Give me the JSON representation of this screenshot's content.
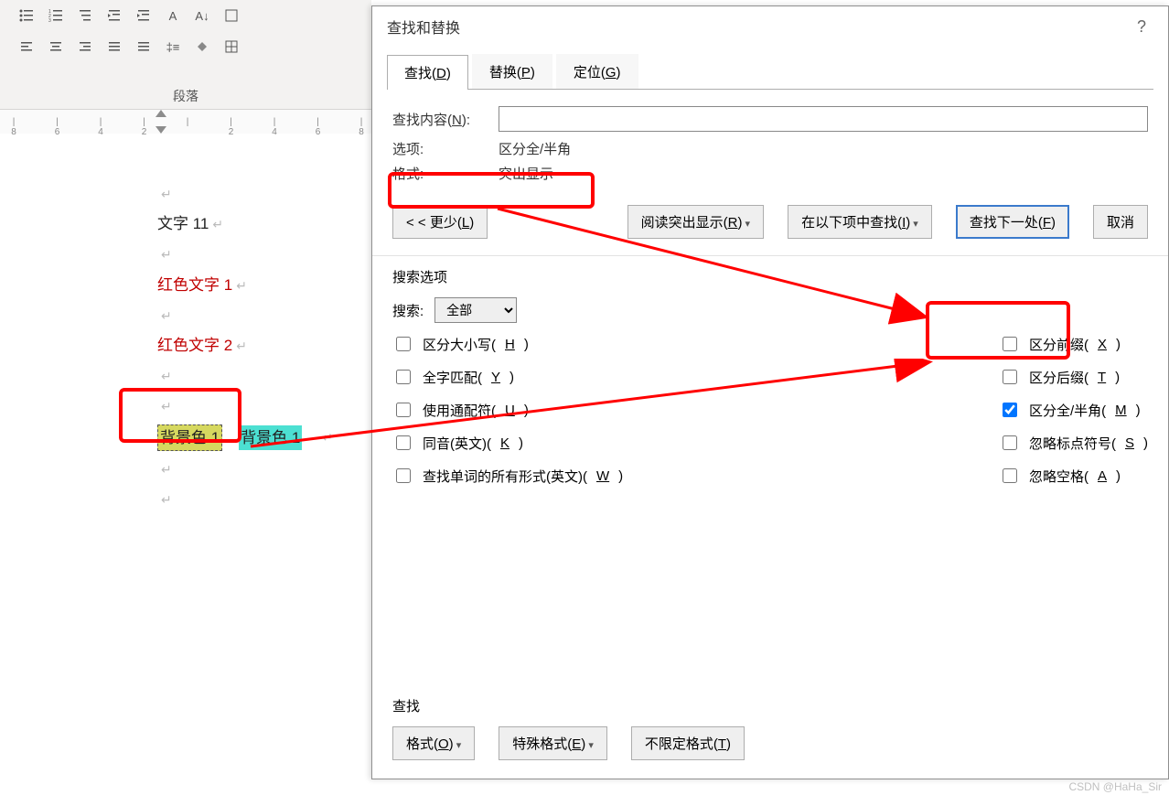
{
  "ribbon": {
    "group_label": "段落"
  },
  "document": {
    "line1": "文字 11",
    "red1": "红色文字 1",
    "red2": "红色文字 2",
    "hl_yellow": "背景色 1",
    "hl_cyan": "背景色 1"
  },
  "dialog": {
    "title": "查找和替换",
    "help": "?",
    "tabs": {
      "find": "查找(D)",
      "replace": "替换(P)",
      "goto": "定位(G)"
    },
    "find_content_label": "查找内容(N):",
    "options_label": "选项:",
    "options_value": "区分全/半角",
    "format_label": "格式:",
    "format_value": "突出显示",
    "buttons": {
      "less": "< < 更少(L)",
      "reading_highlight": "阅读突出显示(R)",
      "find_in": "在以下项中查找(I)",
      "find_next": "查找下一处(F)",
      "cancel": "取消"
    },
    "search_options": {
      "title": "搜索选项",
      "search_label": "搜索:",
      "search_value": "全部",
      "match_case": "区分大小写(H)",
      "whole_word": "全字匹配(Y)",
      "wildcards": "使用通配符(U)",
      "sounds_like": "同音(英文)(K)",
      "word_forms": "查找单词的所有形式(英文)(W)",
      "prefix": "区分前缀(X)",
      "suffix": "区分后缀(T)",
      "full_half": "区分全/半角(M)",
      "punctuation": "忽略标点符号(S)",
      "whitespace": "忽略空格(A)"
    },
    "find_section": {
      "title": "查找",
      "format": "格式(O)",
      "special": "特殊格式(E)",
      "no_format": "不限定格式(T)"
    },
    "find_input_value": ""
  },
  "ruler": {
    "marks": [
      "8",
      "6",
      "4",
      "2",
      "",
      "2",
      "4",
      "6",
      "8"
    ]
  },
  "watermark": "CSDN @HaHa_Sir"
}
